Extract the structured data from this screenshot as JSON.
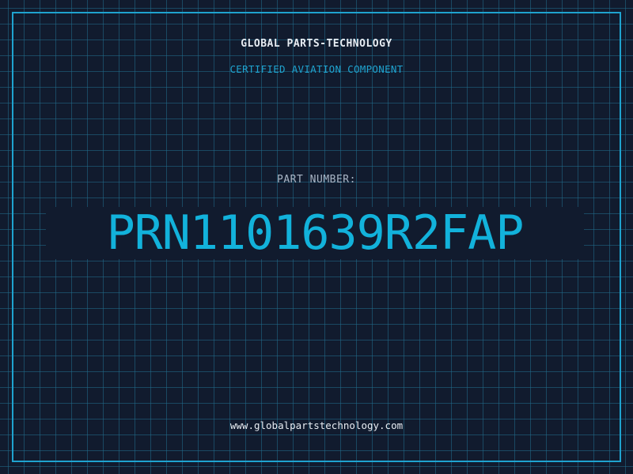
{
  "header": {
    "company": "GLOBAL PARTS-TECHNOLOGY",
    "subtitle": "CERTIFIED AVIATION COMPONENT"
  },
  "part": {
    "label": "PART NUMBER:",
    "number": "PRN1101639R2FAP"
  },
  "footer": {
    "website": "www.globalpartstechnology.com"
  },
  "colors": {
    "background": "#111b2e",
    "grid": "#206e8c",
    "accent": "#1fa3cf",
    "part_number": "#12b2db",
    "text_light": "#e8edf3",
    "text_muted": "#a9b6c6"
  }
}
